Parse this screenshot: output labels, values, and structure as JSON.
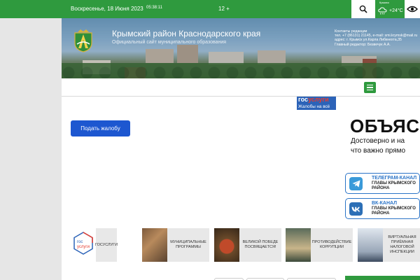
{
  "topbar": {
    "date": "Воскресенье, 18 Июня 2023",
    "time": "05:38:11",
    "age_rating": "12 +",
    "weather": {
      "city": "Крымск",
      "temp": "+24°C"
    },
    "search_icon": "search-icon",
    "accessibility_icon": "eye-icon"
  },
  "header": {
    "title": "Крымский район Краснодарского края",
    "subtitle": "Официальный сайт муниципального образования",
    "contacts": [
      "Контакты редакции",
      "тел. +7 (86131) 21145, e-mail: smi.krymsk@mail.ru",
      "адрес: г. Крымск ул.Карла Либкнехта,35",
      "Главный редактор: Безвечук А.А."
    ]
  },
  "gosuslugi_banner": {
    "logo_part1": "гос",
    "logo_part2": "услуги",
    "caption": "Жалобы на всё"
  },
  "complaint_button": "Подать жалобу",
  "explain": {
    "headline": "ОБЪЯС",
    "line1": "Достоверно и на",
    "line2": "что важно прямо"
  },
  "channels": {
    "telegram": {
      "heading": "ТЕЛЕГРАМ-КАНАЛ",
      "sub": "ГЛАВЫ КРЫМСКОГО РАЙОНА",
      "icon": "telegram-icon"
    },
    "vk": {
      "heading": "ВК-КАНАЛ",
      "sub": "ГЛАВЫ КРЫМСКОГО РАЙОНА",
      "icon": "vk-icon"
    }
  },
  "tiles": [
    {
      "label": "ГОСУСЛУГИ",
      "logo1": "гос",
      "logo2": "услуги"
    },
    {
      "label": "МУНИЦИПАЛЬНЫЕ ПРОГРАММЫ"
    },
    {
      "label": "ВЕЛИКОЙ ПОБЕДЕ ПОСВЯЩАЕТСЯ!"
    },
    {
      "label": "ПРОТИВОДЕЙСТВИЕ КОРРУПЦИИ"
    },
    {
      "label": "ВИРТУАЛЬНАЯ ПРИЁМНАЯ НАЛОГОВОЙ ИНСПЕКЦИИ"
    }
  ],
  "colors": {
    "green": "#2f9a3e",
    "blue_button": "#1d57d0",
    "channel_blue": "#2b74c7"
  }
}
